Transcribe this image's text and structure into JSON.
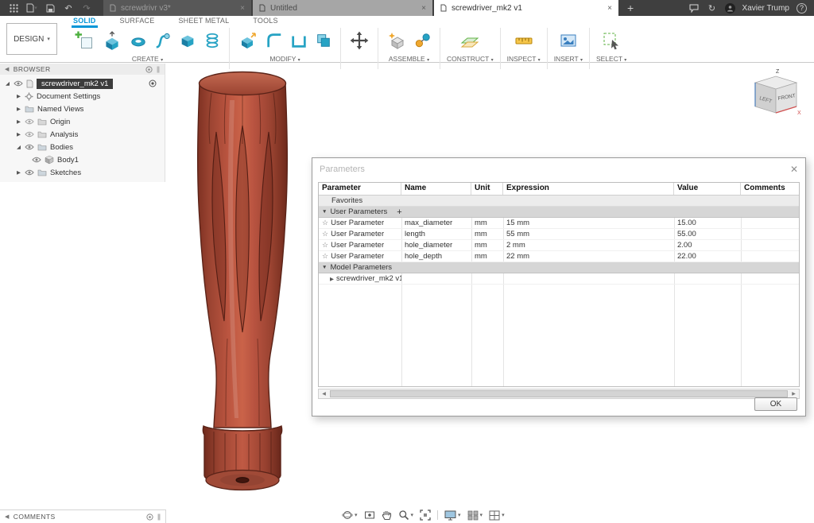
{
  "colors": {
    "accent": "#0696d7",
    "model_red": "#b0513b",
    "titlebar_bg": "#3f3f3f"
  },
  "titlebar": {
    "tabs": [
      {
        "label": "screwdrivr v3*"
      },
      {
        "label": "Untitled"
      },
      {
        "label": "screwdriver_mk2 v1"
      }
    ],
    "user_name": "Xavier Trump",
    "help_label": "?"
  },
  "toolbar": {
    "design_label": "DESIGN",
    "ribbon_tabs": [
      {
        "label": "SOLID"
      },
      {
        "label": "SURFACE"
      },
      {
        "label": "SHEET METAL"
      },
      {
        "label": "TOOLS"
      }
    ],
    "groups": {
      "create": "CREATE",
      "modify": "MODIFY",
      "assemble": "ASSEMBLE",
      "construct": "CONSTRUCT",
      "inspect": "INSPECT",
      "insert": "INSERT",
      "select": "SELECT"
    }
  },
  "browser": {
    "panel_title": "BROWSER",
    "root_label": "screwdriver_mk2 v1",
    "items": [
      {
        "label": "Document Settings"
      },
      {
        "label": "Named Views"
      },
      {
        "label": "Origin"
      },
      {
        "label": "Analysis"
      },
      {
        "label": "Bodies"
      },
      {
        "label": "Body1"
      },
      {
        "label": "Sketches"
      }
    ]
  },
  "dialog": {
    "title": "Parameters",
    "columns": [
      "Parameter",
      "Name",
      "Unit",
      "Expression",
      "Value",
      "Comments"
    ],
    "rows": [
      {
        "label": "Favorites"
      },
      {
        "label": "User Parameters"
      },
      {
        "parameter": "User Parameter",
        "name": "max_diameter",
        "unit": "mm",
        "expression": "15 mm",
        "value": "15.00",
        "comments": ""
      },
      {
        "parameter": "User Parameter",
        "name": "length",
        "unit": "mm",
        "expression": "55 mm",
        "value": "55.00",
        "comments": ""
      },
      {
        "parameter": "User Parameter",
        "name": "hole_diameter",
        "unit": "mm",
        "expression": "2 mm",
        "value": "2.00",
        "comments": ""
      },
      {
        "parameter": "User Parameter",
        "name": "hole_depth",
        "unit": "mm",
        "expression": "22 mm",
        "value": "22.00",
        "comments": ""
      },
      {
        "label": "Model Parameters"
      },
      {
        "label": "screwdriver_mk2 v1"
      }
    ],
    "ok_label": "OK"
  },
  "viewcube": {
    "front": "FRONT",
    "left": "LEFT",
    "z": "Z",
    "x": "X"
  },
  "comments_panel": {
    "title": "COMMENTS"
  }
}
